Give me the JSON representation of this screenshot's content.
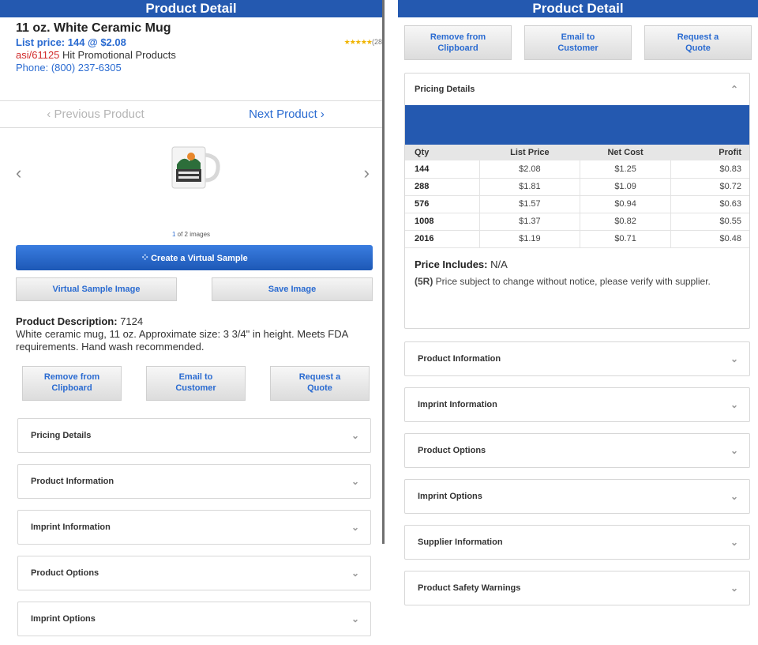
{
  "left": {
    "title": "Product Detail",
    "product_name": "11 oz. White Ceramic Mug",
    "rating_stars": "★★★★★",
    "rating_count": "(28",
    "list_price": "List price: 144 @ $2.08",
    "asi_number": "asi/61125",
    "supplier_name": " Hit Promotional Products",
    "phone": "Phone: (800) 237-6305",
    "prev_product": "‹ Previous Product",
    "next_product": "Next Product ›",
    "image_count_current": "1",
    "image_count_rest": " of 2 images",
    "virtual_sample_button": "Create a Virtual Sample",
    "virtual_sample_image_button": "Virtual Sample Image",
    "save_image_button": "Save Image",
    "description_label": "Product Description:",
    "description_id": " 7124",
    "description_text": "White ceramic mug, 11 oz. Approximate size: 3 3/4\" in height. Meets FDA requirements. Hand wash recommended.",
    "actions": {
      "remove_line1": "Remove from",
      "remove_line2": "Clipboard",
      "email_line1": "Email to",
      "email_line2": "Customer",
      "quote_line1": "Request a",
      "quote_line2": "Quote"
    },
    "sections": [
      "Pricing Details",
      "Product Information",
      "Imprint Information",
      "Product Options",
      "Imprint Options"
    ]
  },
  "right": {
    "title": "Product Detail",
    "actions": {
      "remove_line1": "Remove from",
      "remove_line2": "Clipboard",
      "email_line1": "Email to",
      "email_line2": "Customer",
      "quote_line1": "Request a",
      "quote_line2": "Quote"
    },
    "pricing": {
      "header": "Pricing Details",
      "columns": [
        "Qty",
        "List Price",
        "Net Cost",
        "Profit"
      ],
      "rows": [
        [
          "144",
          "$2.08",
          "$1.25",
          "$0.83"
        ],
        [
          "288",
          "$1.81",
          "$1.09",
          "$0.72"
        ],
        [
          "576",
          "$1.57",
          "$0.94",
          "$0.63"
        ],
        [
          "1008",
          "$1.37",
          "$0.82",
          "$0.55"
        ],
        [
          "2016",
          "$1.19",
          "$0.71",
          "$0.48"
        ]
      ],
      "price_includes_label": "Price Includes:",
      "price_includes_value": " N/A",
      "note_code": "(5R)",
      "note_text": " Price subject to change without notice, please verify with supplier."
    },
    "sections": [
      "Product Information",
      "Imprint Information",
      "Product Options",
      "Imprint Options",
      "Supplier Information",
      "Product Safety Warnings"
    ]
  },
  "icons": {
    "chevron_down": "⌄",
    "chevron_up": "⌃",
    "arrow_left": "‹",
    "arrow_right": "›"
  },
  "colors": {
    "header_blue": "#2459b0",
    "link_blue": "#2a6bd1",
    "asi_red": "#d12b2b"
  }
}
